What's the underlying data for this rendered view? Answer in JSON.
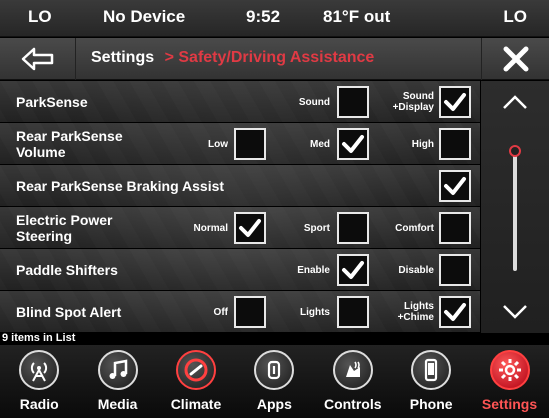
{
  "status": {
    "left": "LO",
    "device": "No Device",
    "time": "9:52",
    "temp": "81°F out",
    "right": "LO"
  },
  "header": {
    "crumb_root": "Settings",
    "crumb_sep": ">",
    "crumb_current": "Safety/Driving Assistance"
  },
  "rows": [
    {
      "label": "ParkSense",
      "options": [
        {
          "label": "Sound",
          "checked": false
        },
        {
          "label": "Sound +Display",
          "checked": true
        }
      ]
    },
    {
      "label": "Rear ParkSense Volume",
      "options": [
        {
          "label": "Low",
          "checked": false
        },
        {
          "label": "Med",
          "checked": true
        },
        {
          "label": "High",
          "checked": false
        }
      ]
    },
    {
      "label": "Rear ParkSense Braking Assist",
      "options": [
        {
          "label": "",
          "checked": true
        }
      ]
    },
    {
      "label": "Electric Power Steering",
      "options": [
        {
          "label": "Normal",
          "checked": true
        },
        {
          "label": "Sport",
          "checked": false
        },
        {
          "label": "Comfort",
          "checked": false
        }
      ]
    },
    {
      "label": "Paddle Shifters",
      "options": [
        {
          "label": "Enable",
          "checked": true
        },
        {
          "label": "Disable",
          "checked": false
        }
      ]
    },
    {
      "label": "Blind Spot Alert",
      "options": [
        {
          "label": "Off",
          "checked": false
        },
        {
          "label": "Lights",
          "checked": false
        },
        {
          "label": "Lights +Chime",
          "checked": true
        }
      ]
    }
  ],
  "list_count": "9 items in List",
  "nav": [
    {
      "label": "Radio",
      "icon": "radio-icon"
    },
    {
      "label": "Media",
      "icon": "music-note-icon"
    },
    {
      "label": "Climate",
      "icon": "climate-icon"
    },
    {
      "label": "Apps",
      "icon": "apps-icon"
    },
    {
      "label": "Controls",
      "icon": "controls-icon"
    },
    {
      "label": "Phone",
      "icon": "phone-icon"
    },
    {
      "label": "Settings",
      "icon": "gear-icon",
      "active": true
    }
  ],
  "colors": {
    "accent_red": "#e03a44",
    "active_red": "#ff4040"
  }
}
